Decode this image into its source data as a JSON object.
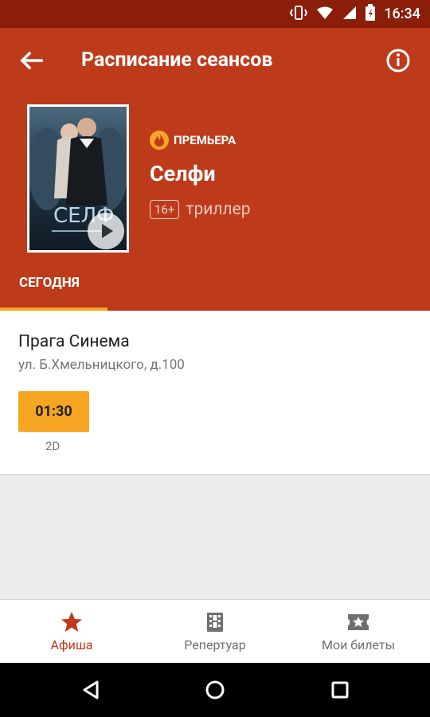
{
  "status": {
    "time": "16:34"
  },
  "header": {
    "title": "Расписание сеансов"
  },
  "movie": {
    "premiere_label": "ПРЕМЬЕРА",
    "title": "Селфи",
    "age_rating": "16+",
    "genre": "триллер"
  },
  "tabs": [
    {
      "label": "СЕГОДНЯ"
    }
  ],
  "cinema": {
    "name": "Прага Синема",
    "address": "ул. Б.Хмельницкого, д.100",
    "sessions": [
      {
        "time": "01:30",
        "format": "2D"
      }
    ]
  },
  "bottom_nav": [
    {
      "label": "Афиша"
    },
    {
      "label": "Репертуар"
    },
    {
      "label": "Мои билеты"
    }
  ]
}
